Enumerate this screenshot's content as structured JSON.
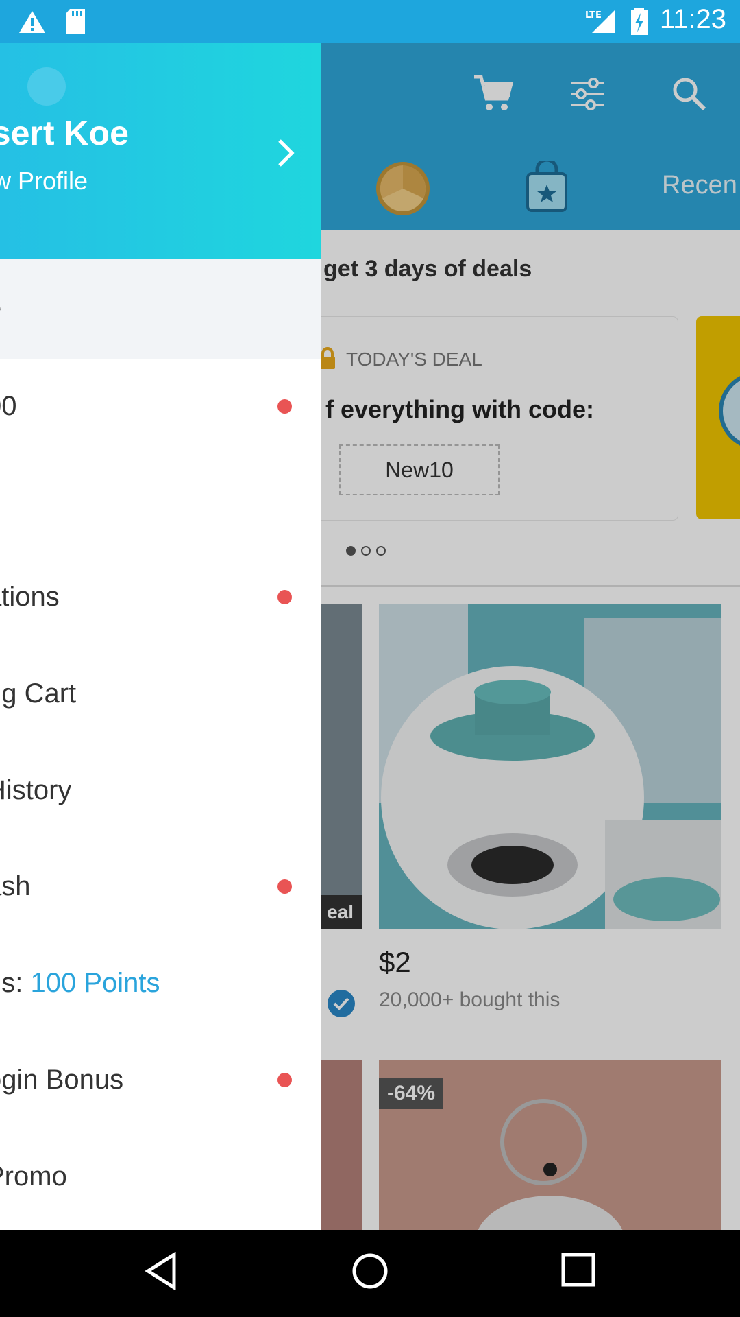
{
  "status_bar": {
    "time": "11:23",
    "network": "LTE"
  },
  "toolbar": {
    "icons": [
      "cart-icon",
      "filter-icon",
      "search-icon"
    ]
  },
  "tabs": {
    "recent_label": "Recen"
  },
  "promo": {
    "title": "get 3 days of deals",
    "deal_label": "TODAY'S DEAL",
    "deal_headline": "f everything with code:",
    "deal_code": "New10",
    "page_dots": 3,
    "active_dot": 1
  },
  "products": [
    {
      "partial_tag": "eal"
    },
    {
      "price": "$2",
      "bought": "20,000+ bought this"
    },
    {
      "discount": "-64%"
    }
  ],
  "drawer": {
    "name": "esert Koe",
    "subtitle": "ew Profile",
    "items": [
      {
        "label": "e",
        "dot": false
      },
      {
        "label": "00",
        "dot": true
      },
      {
        "label": "ations",
        "dot": true
      },
      {
        "label": "ng Cart",
        "dot": false
      },
      {
        "label": "History",
        "dot": false
      },
      {
        "label": "ash",
        "dot": true
      },
      {
        "label_prefix": "ds: ",
        "label_accent": "100 Points",
        "dot": false
      },
      {
        "label": "ogin Bonus",
        "dot": true
      },
      {
        "label": "Promo",
        "dot": false
      }
    ]
  },
  "colors": {
    "accent": "#2aa4dc",
    "header_start": "#25c0e4",
    "header_end": "#1fd6de",
    "badge": "#e95454",
    "status_bar": "#1ea6dd"
  }
}
